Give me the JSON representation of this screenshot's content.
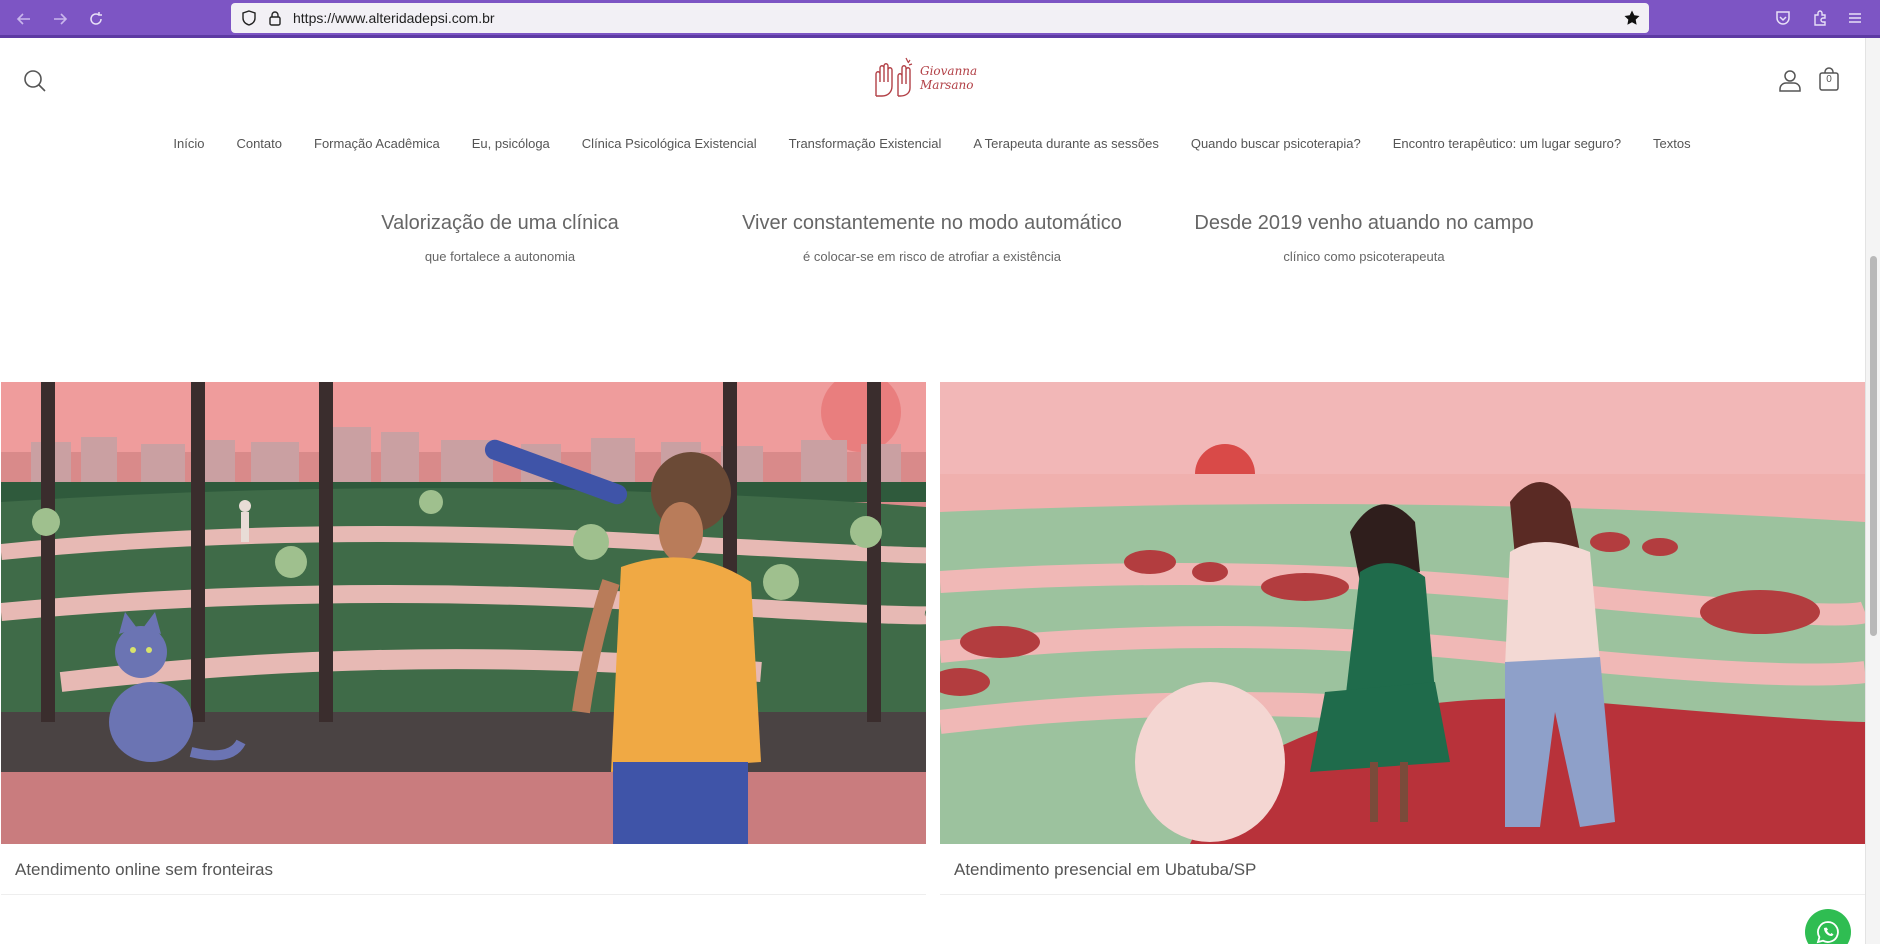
{
  "browser": {
    "url": "https://www.alteridadepsi.com.br"
  },
  "logo": {
    "line1": "Giovanna",
    "line2": "Marsano"
  },
  "cart": {
    "count": "0"
  },
  "menu": [
    "Início",
    "Contato",
    "Formação Acadêmica",
    "Eu, psicóloga",
    "Clínica Psicológica Existencial",
    "Transformação Existencial",
    "A Terapeuta durante as sessões",
    "Quando buscar psicoterapia?",
    "Encontro terapêutico: um lugar seguro?",
    "Textos"
  ],
  "features": [
    {
      "title": "Valorização de uma clínica",
      "subtitle": "que fortalece a autonomia"
    },
    {
      "title": "Viver constantemente no modo automático",
      "subtitle": "é colocar-se em risco de atrofiar a existência"
    },
    {
      "title": "Desde 2019 venho atuando no campo",
      "subtitle": "clínico como psicoterapeuta"
    }
  ],
  "cards": [
    {
      "title": "Atendimento online sem fronteiras"
    },
    {
      "title": "Atendimento presencial em Ubatuba/SP"
    }
  ],
  "colors": {
    "browser_chrome": "#7d55c4",
    "brand": "#b24046",
    "whatsapp": "#2fbd52"
  }
}
